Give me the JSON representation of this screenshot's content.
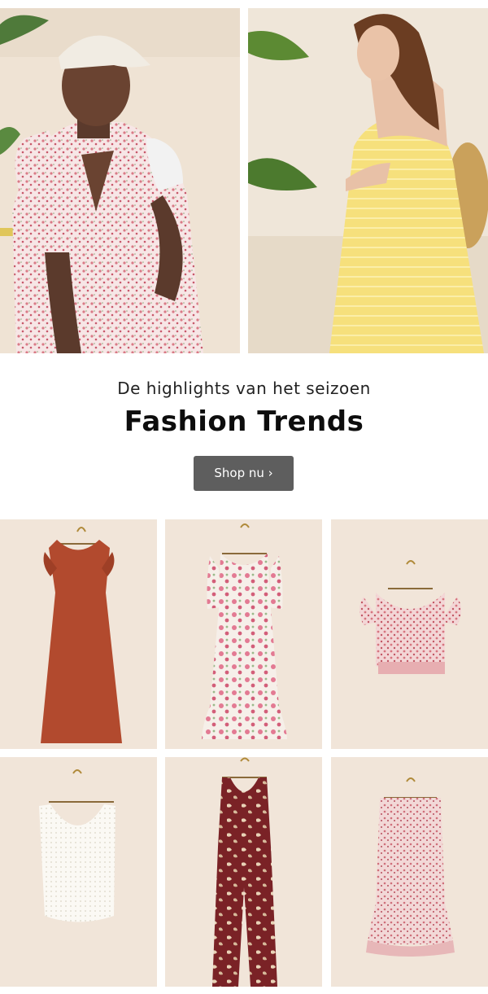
{
  "hero": {
    "left_image": "woman-in-pink-floral-dress-and-cap",
    "right_image": "woman-in-yellow-striped-sundress"
  },
  "headline": {
    "subtitle": "De highlights van het seizoen",
    "title": "Fashion Trends"
  },
  "cta": {
    "label": "Shop nu ›"
  },
  "products": [
    {
      "name": "rust-red-maxi-dress",
      "color": "#b24a2e"
    },
    {
      "name": "white-floral-maxi-dress",
      "color": "#f3ded9"
    },
    {
      "name": "pink-floral-wrap-top",
      "color": "#e9b8b8"
    },
    {
      "name": "white-crochet-tank-top",
      "color": "#f6f4ee"
    },
    {
      "name": "burgundy-floral-jumpsuit",
      "color": "#7a2226"
    },
    {
      "name": "pink-floral-midi-skirt",
      "color": "#e7bfc0"
    }
  ],
  "colors": {
    "button_bg": "#5e5e5e",
    "tile_bg": "#f1e5d9"
  }
}
